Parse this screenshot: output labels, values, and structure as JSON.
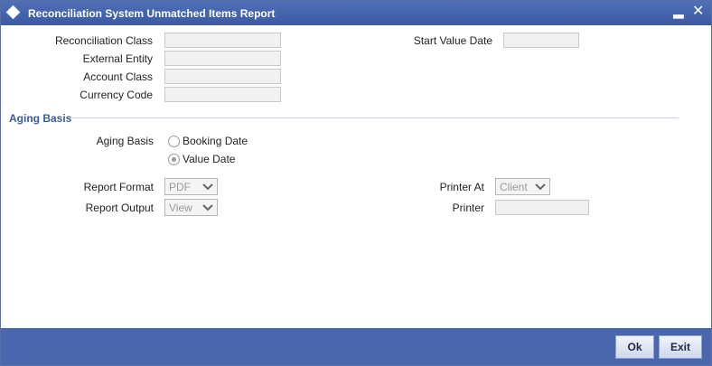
{
  "window": {
    "title": "Reconciliation System Unmatched Items Report",
    "minimize_glyph": "▂",
    "close_glyph": "✕"
  },
  "fields": {
    "reconciliation_class": {
      "label": "Reconciliation Class",
      "value": ""
    },
    "external_entity": {
      "label": "External Entity",
      "value": ""
    },
    "account_class": {
      "label": "Account Class",
      "value": ""
    },
    "currency_code": {
      "label": "Currency Code",
      "value": ""
    },
    "start_value_date": {
      "label": "Start Value Date",
      "value": ""
    }
  },
  "aging": {
    "section_title": "Aging Basis",
    "label": "Aging Basis",
    "options": [
      {
        "label": "Booking Date",
        "checked": false
      },
      {
        "label": "Value Date",
        "checked": true
      }
    ]
  },
  "report": {
    "format_label": "Report Format",
    "format_value": "PDF",
    "output_label": "Report Output",
    "output_value": "View",
    "printer_at_label": "Printer At",
    "printer_at_value": "Client",
    "printer_label": "Printer",
    "printer_value": ""
  },
  "buttons": {
    "ok": "Ok",
    "exit": "Exit"
  },
  "colors": {
    "titlebar": "#3b5aa3",
    "footer": "#4a67ad",
    "section_title": "#3a5b9d"
  }
}
